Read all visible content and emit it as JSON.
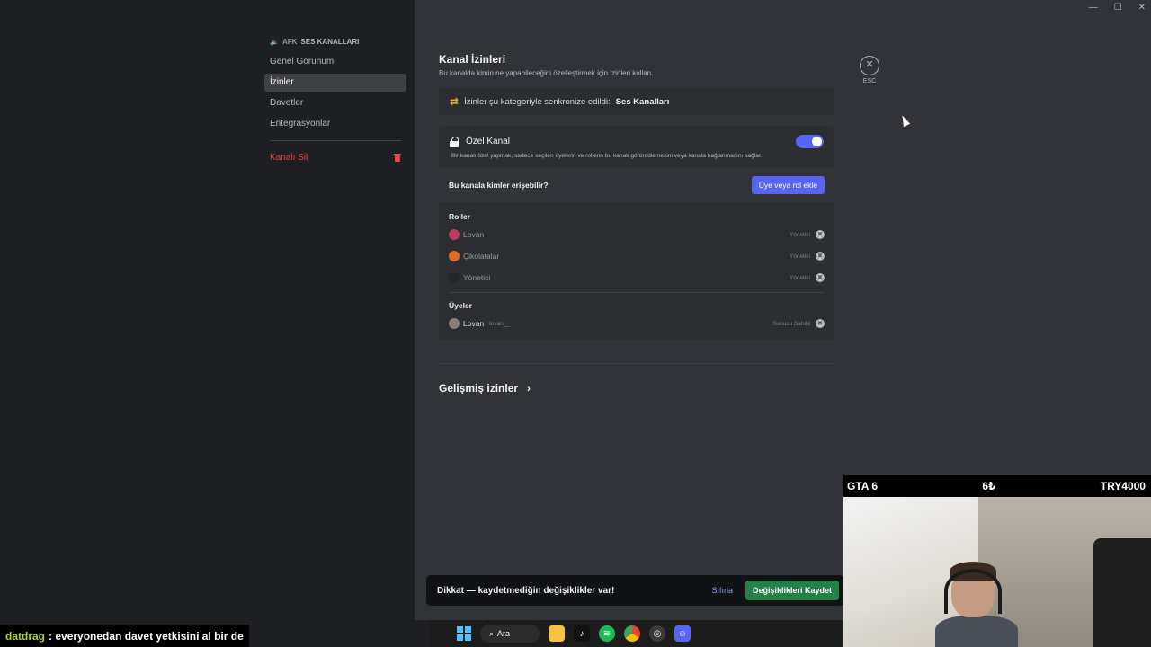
{
  "window_controls": {
    "minimize": "—",
    "maximize": "☐",
    "close": "✕"
  },
  "sidebar": {
    "category_prefix": "AFK",
    "category": "SES KANALLARI",
    "items": [
      {
        "label": "Genel Görünüm",
        "active": false
      },
      {
        "label": "İzinler",
        "active": true
      },
      {
        "label": "Davetler",
        "active": false
      },
      {
        "label": "Entegrasyonlar",
        "active": false
      }
    ],
    "delete_label": "Kanalı Sil"
  },
  "main": {
    "title": "Kanal İzinleri",
    "subtitle": "Bu kanalda kimin ne yapabileceğini özelleştirmek için izinleri kullan.",
    "sync": {
      "text": "İzinler şu kategoriyle senkronize edildi:",
      "category": "Ses Kanalları"
    },
    "private": {
      "label": "Özel Kanal",
      "enabled": true,
      "description": "Bir kanalı özel yapmak, sadece seçilen üyelerin ve rollerin bu kanalı görüntülemesini veya kanala bağlanmasını sağlar."
    },
    "access": {
      "question": "Bu kanala kimler erişebilir?",
      "add_button": "Üye veya rol ekle"
    },
    "roles": {
      "title": "Roller",
      "items": [
        {
          "name": "Lovan",
          "tag": "Yönetici",
          "color": "#c0395e"
        },
        {
          "name": "Çikolatalar",
          "tag": "Yönetici",
          "color": "#e06c2b"
        },
        {
          "name": "Yönetici",
          "tag": "Yönetici",
          "color": "#23252a"
        }
      ]
    },
    "members": {
      "title": "Üyeler",
      "items": [
        {
          "name": "Lovan",
          "username": "lovan__",
          "tag": "Sunucu Sahibi"
        }
      ]
    },
    "advanced": "Gelişmiş izinler"
  },
  "esc": {
    "label": "ESC"
  },
  "savebar": {
    "message": "Dikkat — kaydetmediğin değişiklikler var!",
    "reset": "Sıfırla",
    "save": "Değişiklikleri Kaydet"
  },
  "stream": {
    "cam_bar": {
      "left": "GTA 6",
      "center": "6₺",
      "right": "TRY4000"
    },
    "chat": {
      "user": "datdrag",
      "message": ": everyonedan davet yetkisini al bir de"
    }
  },
  "taskbar": {
    "search": "Ara"
  },
  "colors": {
    "accent": "#5865f2",
    "danger": "#f23f43",
    "success": "#248046"
  }
}
